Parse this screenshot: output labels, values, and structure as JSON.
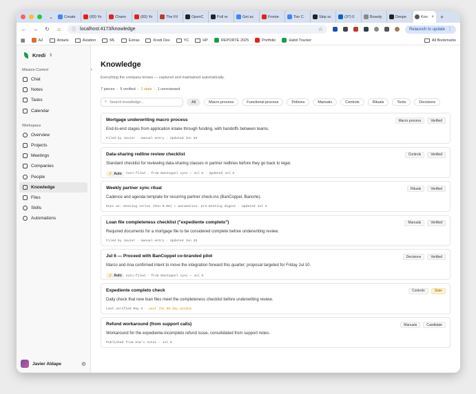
{
  "browser": {
    "tabs": [
      {
        "label": "Create",
        "icon": "google-icon",
        "color": "#4285f4"
      },
      {
        "label": "(83) Yo",
        "icon": "youtube-icon",
        "color": "#e62117"
      },
      {
        "label": "Chann",
        "icon": "youtube-icon",
        "color": "#e62117"
      },
      {
        "label": "(83) Yo",
        "icon": "youtube-icon",
        "color": "#e62117"
      },
      {
        "label": "The Fil",
        "icon": "site-icon",
        "color": "#c0392b"
      },
      {
        "label": "OpenC",
        "icon": "site-icon",
        "color": "#222222"
      },
      {
        "label": "Pull re",
        "icon": "github-icon",
        "color": "#222222"
      },
      {
        "label": "Get ac",
        "icon": "google-icon",
        "color": "#4285f4"
      },
      {
        "label": "Fronte",
        "icon": "youtube-icon",
        "color": "#e62117"
      },
      {
        "label": "Tier C",
        "icon": "google-icon",
        "color": "#4285f4"
      },
      {
        "label": "Skip sc",
        "icon": "github-icon",
        "color": "#222222"
      },
      {
        "label": "(37) 0",
        "icon": "linkedin-icon",
        "color": "#0a66c2"
      },
      {
        "label": "Boardy",
        "icon": "site-icon",
        "color": "#8a8a8a"
      },
      {
        "label": "Despe",
        "icon": "site-icon",
        "color": "#222222"
      }
    ],
    "active_tab": {
      "label": "Kno",
      "color": "#555555"
    },
    "url": "localhost:4173/knowledge",
    "relaunch_label": "Relaunch to update",
    "bookmarks": [
      {
        "label": "AZ",
        "icon": "site-icon",
        "color": "#e66b1e"
      },
      {
        "label": "Antaris",
        "icon": "folder-icon"
      },
      {
        "label": "Aviation",
        "icon": "folder-icon"
      },
      {
        "label": "ML",
        "icon": "folder-icon"
      },
      {
        "label": "Extras",
        "icon": "folder-icon"
      },
      {
        "label": "Kredi Dev",
        "icon": "folder-icon"
      },
      {
        "label": "YC",
        "icon": "folder-icon"
      },
      {
        "label": "HP",
        "icon": "folder-icon"
      },
      {
        "label": "REPORTE 2025",
        "icon": "sheets-icon",
        "color": "#1e9a4e"
      },
      {
        "label": "Portfolio",
        "icon": "youtube-icon",
        "color": "#e62117"
      },
      {
        "label": "Habit Tracker",
        "icon": "sheets-icon",
        "color": "#1e9a4e"
      }
    ],
    "all_bookmarks_label": "All Bookmarks"
  },
  "sidebar": {
    "brand": "Kredi",
    "section1": "Mission Control",
    "items1": [
      {
        "label": "Chat",
        "icon": "chat-icon"
      },
      {
        "label": "Notes",
        "icon": "notes-icon"
      },
      {
        "label": "Tasks",
        "icon": "tasks-icon"
      },
      {
        "label": "Calendar",
        "icon": "calendar-icon"
      }
    ],
    "section2": "Workspace",
    "items2": [
      {
        "label": "Overview",
        "icon": "overview-icon"
      },
      {
        "label": "Projects",
        "icon": "projects-icon"
      },
      {
        "label": "Meetings",
        "icon": "meetings-icon"
      },
      {
        "label": "Companies",
        "icon": "companies-icon"
      },
      {
        "label": "People",
        "icon": "people-icon"
      },
      {
        "label": "Knowledge",
        "icon": "knowledge-icon",
        "active": true
      },
      {
        "label": "Files",
        "icon": "files-icon"
      },
      {
        "label": "Skills",
        "icon": "skills-icon"
      },
      {
        "label": "Automations",
        "icon": "automations-icon"
      }
    ],
    "user": "Javier Aldape"
  },
  "main": {
    "title": "Knowledge",
    "subtitle": "Everything the company knows — captured and maintained automatically.",
    "stats": {
      "pieces": "7 pieces",
      "verified": "5 verified",
      "stale": "1 stale",
      "unreviewed": "1 unreviewed",
      "sep": "·"
    },
    "search_placeholder": "Search knowledge...",
    "filters": [
      "All",
      "Macro process",
      "Functional process",
      "Policies",
      "Manuals",
      "Controls",
      "Rituals",
      "Tools",
      "Decisions"
    ],
    "active_filter": "All",
    "cards": [
      {
        "title": "Mortgage underwriting macro process",
        "desc": "End-to-end stages from application intake through funding, with handoffs between teams.",
        "meta": "Filed by Javier · manual entry · Updated Jun 29",
        "category": "Macro process",
        "status": "Verified"
      },
      {
        "title": "Data-sharing redline review checklist",
        "desc": "Standard checklist for reviewing data-sharing clauses in partner redlines before they go back to legal.",
        "auto": "Auto",
        "meta": "Auto-filed · from BanCoppel sync — Jul 6 · Updated Jul 6",
        "category": "Controls",
        "status": "Verified"
      },
      {
        "title": "Weekly partner sync ritual",
        "desc": "Cadence and agenda template for recurring partner check-ins (BanCoppel, Banorte).",
        "meta": "Runs as: meeting series (Mon 9:00) + automation: pre-meeting digest · Updated Jul 3",
        "category": "Rituals",
        "status": "Verified"
      },
      {
        "title": "Loan file completeness checklist (\"expediente completo\")",
        "desc": "Required documents for a mortgage file to be considered complete before underwriting review.",
        "meta": "Filed by Javier · manual entry · Updated Jun 28",
        "category": "Manuals",
        "status": "Verified"
      },
      {
        "title": "Jul 6 — Proceed with BanCoppel co-branded pilot",
        "desc": "Marco and Ana confirmed intent to move the integration forward this quarter; proposal targeted for Friday Jul 10.",
        "auto": "Auto",
        "meta": "Auto-filed · from BanCoppel sync — Jul 6",
        "category": "Decisions",
        "status": "Verified"
      },
      {
        "title": "Expediente completo check",
        "desc": "Daily check that new loan files meet the completeness checklist before underwriting review.",
        "meta": "Last verified May 5 ·",
        "meta_warn": "past the 60-day window",
        "category": "Controls",
        "status": "Stale"
      },
      {
        "title": "Refund workaround (from support calls)",
        "desc": "Workaround for the expediente-incompleto refund issue, consolidated from support notes.",
        "meta": "Published from Ana's notes · Jul 8",
        "category": "Manuals",
        "status": "Candidate"
      }
    ]
  },
  "colors": {
    "accent": "#1e9a4e",
    "stale": "#d88a00",
    "lights": [
      "#ff5f57",
      "#febc2e",
      "#28c840"
    ]
  }
}
